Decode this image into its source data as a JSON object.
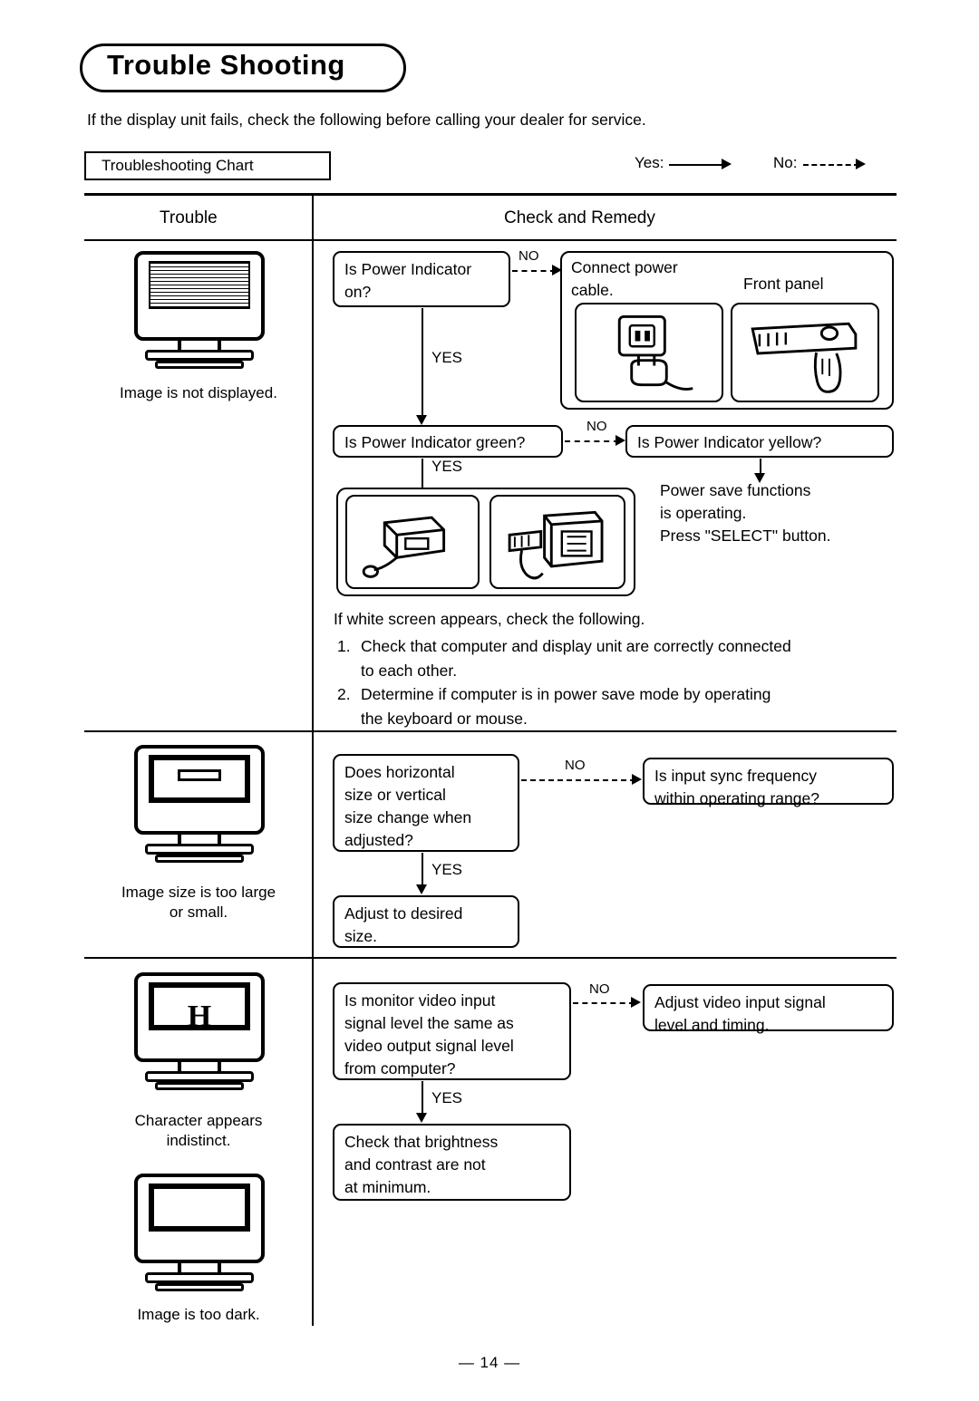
{
  "document": {
    "title": "Trouble Shooting",
    "intro": "If the display unit fails, check the following before calling your dealer for service.",
    "chart_label": "Troubleshooting Chart",
    "page_number": "— 14 —"
  },
  "legend": {
    "yes_label": "Yes:",
    "no_label": "No:"
  },
  "table_headers": {
    "trouble": "Trouble",
    "check_and_remedy": "Check and Remedy"
  },
  "rows": [
    {
      "caption": "Image is not displayed.",
      "icon": "monitor-blank-icon",
      "nodes": {
        "q1": "Is Power Indicator\non?",
        "q1_no_label": "NO",
        "q1_yes_label": "YES",
        "a1": "Connect power\ncable.",
        "a1_caption": "Front panel",
        "q2": "Is Power Indicator green?",
        "q2_no_label": "NO",
        "q2_yes_label": "YES",
        "a2": "Is Power Indicator yellow?",
        "a2_note": "Power save functions\nis operating.\nPress \"SELECT\" button."
      },
      "notes": {
        "lead": "If white screen appears, check the following.",
        "item1_num": "1.",
        "item1": "Check that computer and display unit are correctly connected\nto each other.",
        "item2_num": "2.",
        "item2": "Determine if computer is in power save mode by operating\nthe keyboard or mouse."
      }
    },
    {
      "caption": "Image size is too large\nor small.",
      "icon": "monitor-size-icon",
      "nodes": {
        "q1": "Does horizontal\nsize or vertical\nsize change when\nadjusted?",
        "q1_no_label": "NO",
        "q1_yes_label": "YES",
        "a1": "Is input sync frequency\nwithin operating range?",
        "a2": "Adjust to desired\nsize."
      }
    },
    {
      "caption": "Character appears\nindistinct.",
      "icon": "monitor-character-icon",
      "caption2": "Image is too dark.",
      "icon2": "monitor-dark-icon",
      "nodes": {
        "q1": "Is monitor video input\nsignal level the same as\nvideo output signal level\nfrom computer?",
        "q1_no_label": "NO",
        "q1_yes_label": "YES",
        "a1": "Adjust video input signal\nlevel and timing.",
        "a2": "Check that brightness\nand contrast are not\nat minimum."
      }
    }
  ]
}
